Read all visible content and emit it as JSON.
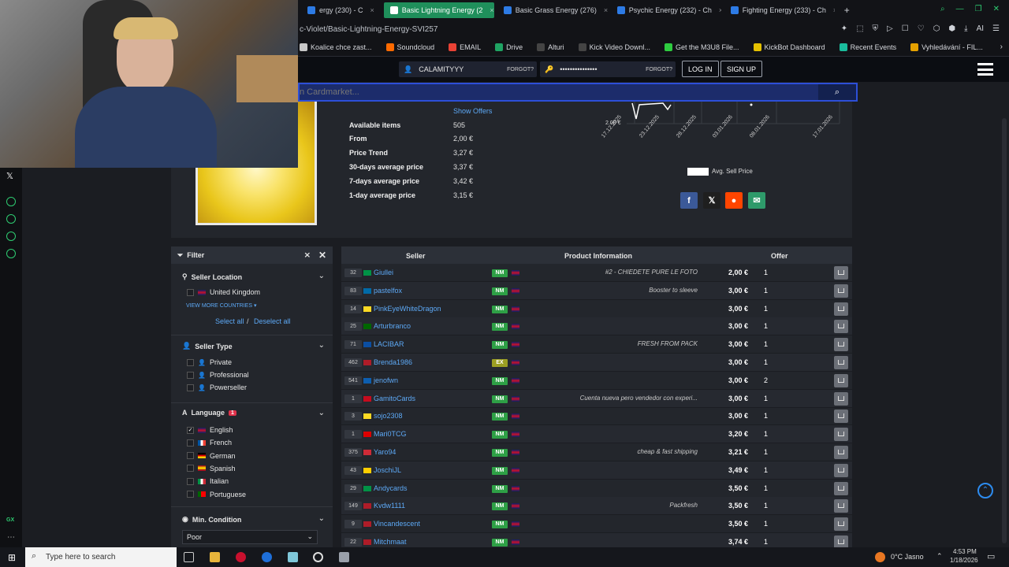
{
  "tabs": [
    {
      "label": "ergy (230) - C",
      "active": false,
      "color": "#2d7be5"
    },
    {
      "label": "Basic Lightning Energy (2",
      "active": true,
      "color": "#ffffff"
    },
    {
      "label": "Basic Grass Energy (276)",
      "active": false,
      "color": "#2d7be5"
    },
    {
      "label": "Psychic Energy (232) - Ch",
      "active": false,
      "color": "#2d7be5"
    },
    {
      "label": "Fighting Energy (233) - Ch",
      "active": false,
      "color": "#2d7be5"
    }
  ],
  "url": "c-Violet/Basic-Lightning-Energy-SVI257",
  "bookmarks": [
    {
      "label": "Koalice chce zast...",
      "color": "#c8c8c8"
    },
    {
      "label": "Soundcloud",
      "color": "#ff6a00"
    },
    {
      "label": "EMAIL",
      "color": "#e94235"
    },
    {
      "label": "Drive",
      "color": "#1fa463"
    },
    {
      "label": "Alturi",
      "color": "#444"
    },
    {
      "label": "Kick Video Downl...",
      "color": "#444"
    },
    {
      "label": "Get the M3U8 File...",
      "color": "#2ecc40"
    },
    {
      "label": "KickBot Dashboard",
      "color": "#e5c100"
    },
    {
      "label": "Recent Events",
      "color": "#1abc9c"
    },
    {
      "label": "Vyhledávání - FIL...",
      "color": "#e5a100"
    }
  ],
  "header": {
    "username": "CALAMITYYY",
    "password": "•••••••••••••••",
    "forgot1": "FORGOT?",
    "forgot2": "FORGOT?",
    "login": "LOG IN",
    "signup": "SIGN UP"
  },
  "search": {
    "placeholder": "n Cardmarket..."
  },
  "product": {
    "show_offers": "Show Offers",
    "stats": [
      {
        "label": "Available items",
        "value": "505"
      },
      {
        "label": "From",
        "value": "2,00 €"
      },
      {
        "label": "Price Trend",
        "value": "3,27 €"
      },
      {
        "label": "30-days average price",
        "value": "3,37 €"
      },
      {
        "label": "7-days average price",
        "value": "3,42 €"
      },
      {
        "label": "1-day average price",
        "value": "3,15 €"
      }
    ],
    "chart_ylabel": "2.00 €",
    "chart_dates": [
      "17.12.2025",
      "23.12.2025",
      "28.12.2025",
      "03.01.2026",
      "08.01.2026",
      "17.01.2026"
    ],
    "chart_legend": "Avg. Sell Price"
  },
  "filter": {
    "title": "Filter",
    "seller_location": "Seller Location",
    "country": "United Kingdom",
    "view_more": "VIEW MORE COUNTRIES ▾",
    "select_all": "Select all",
    "sep": "/",
    "deselect_all": "Deselect all",
    "seller_type": "Seller Type",
    "types": [
      "Private",
      "Professional",
      "Powerseller"
    ],
    "language": "Language",
    "language_badge": "1",
    "languages": [
      {
        "name": "English",
        "checked": true
      },
      {
        "name": "French",
        "checked": false
      },
      {
        "name": "German",
        "checked": false
      },
      {
        "name": "Spanish",
        "checked": false
      },
      {
        "name": "Italian",
        "checked": false
      },
      {
        "name": "Portuguese",
        "checked": false
      }
    ],
    "min_condition": "Min. Condition",
    "condition_value": "Poor"
  },
  "table": {
    "headers": {
      "seller": "Seller",
      "product": "Product Information",
      "offer": "Offer"
    },
    "rows": [
      {
        "count": "32",
        "seller": "Giullei",
        "cond": "NM",
        "comment": "#2 - CHIEDETE PURE LE FOTO",
        "price": "2,00 €",
        "qty": "1"
      },
      {
        "count": "83",
        "seller": "pastelfox",
        "cond": "NM",
        "comment": "Booster to sleeve",
        "price": "3,00 €",
        "qty": "1"
      },
      {
        "count": "14",
        "seller": "PinkEyeWhiteDragon",
        "cond": "NM",
        "comment": "",
        "price": "3,00 €",
        "qty": "1"
      },
      {
        "count": "25",
        "seller": "Arturbranco",
        "cond": "NM",
        "comment": "",
        "price": "3,00 €",
        "qty": "1"
      },
      {
        "count": "71",
        "seller": "LACIBAR",
        "cond": "NM",
        "comment": "FRESH FROM PACK",
        "price": "3,00 €",
        "qty": "1"
      },
      {
        "count": "462",
        "seller": "Brenda1986",
        "cond": "EX",
        "comment": "",
        "price": "3,00 €",
        "qty": "1"
      },
      {
        "count": "541",
        "seller": "jenofwn",
        "cond": "NM",
        "comment": "",
        "price": "3,00 €",
        "qty": "2"
      },
      {
        "count": "1",
        "seller": "GamitoCards",
        "cond": "NM",
        "comment": "Cuenta nueva pero vendedor con experi...",
        "price": "3,00 €",
        "qty": "1"
      },
      {
        "count": "3",
        "seller": "sojo2308",
        "cond": "NM",
        "comment": "",
        "price": "3,00 €",
        "qty": "1"
      },
      {
        "count": "1",
        "seller": "Mari0TCG",
        "cond": "NM",
        "comment": "",
        "price": "3,20 €",
        "qty": "1"
      },
      {
        "count": "375",
        "seller": "Yaro94",
        "cond": "NM",
        "comment": "cheap & fast shipping",
        "price": "3,21 €",
        "qty": "1"
      },
      {
        "count": "43",
        "seller": "JoschiJL",
        "cond": "NM",
        "comment": "",
        "price": "3,49 €",
        "qty": "1"
      },
      {
        "count": "29",
        "seller": "Andycards",
        "cond": "NM",
        "comment": "",
        "price": "3,50 €",
        "qty": "1"
      },
      {
        "count": "149",
        "seller": "Kvdw1111",
        "cond": "NM",
        "comment": "Packfresh",
        "price": "3,50 €",
        "qty": "1"
      },
      {
        "count": "9",
        "seller": "Vincandescent",
        "cond": "NM",
        "comment": "",
        "price": "3,50 €",
        "qty": "1"
      },
      {
        "count": "22",
        "seller": "Mitchmaat",
        "cond": "NM",
        "comment": "",
        "price": "3,74 €",
        "qty": "1"
      }
    ]
  },
  "taskbar": {
    "search_placeholder": "Type here to search",
    "weather": "0°C  Jasno",
    "time": "4:53 PM",
    "date": "1/18/2026"
  }
}
